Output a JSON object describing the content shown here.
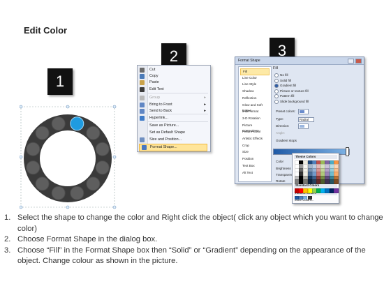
{
  "title": "Edit Color",
  "badges": [
    "1",
    "2",
    "3"
  ],
  "context_menu": {
    "items": [
      {
        "label": "Cut",
        "icon": "scissors-icon",
        "color": "#6b6b6b",
        "disabled": false,
        "submenu": false,
        "active": false
      },
      {
        "label": "Copy",
        "icon": "copy-icon",
        "color": "#4a7ab8",
        "disabled": false,
        "submenu": false,
        "active": false
      },
      {
        "label": "Paste",
        "icon": "paste-icon",
        "color": "#c9a24a",
        "disabled": false,
        "submenu": false,
        "active": false
      },
      {
        "label": "Edit Text",
        "icon": "edit-text-icon",
        "color": "#3b3b3b",
        "disabled": false,
        "submenu": false,
        "active": false
      },
      {
        "label": "Group",
        "icon": "group-icon",
        "color": "#b9b9b9",
        "disabled": true,
        "submenu": true,
        "active": false
      },
      {
        "label": "Bring to Front",
        "icon": "bring-front-icon",
        "color": "#5f86c4",
        "disabled": false,
        "submenu": true,
        "active": false
      },
      {
        "label": "Send to Back",
        "icon": "send-back-icon",
        "color": "#5f86c4",
        "disabled": false,
        "submenu": true,
        "active": false
      },
      {
        "label": "Hyperlink...",
        "icon": "hyperlink-icon",
        "color": "#3f7bc8",
        "disabled": false,
        "submenu": false,
        "active": false
      },
      {
        "label": "Save as Picture...",
        "icon": "",
        "color": "",
        "disabled": false,
        "submenu": false,
        "active": false
      },
      {
        "label": "Set as Default Shape",
        "icon": "",
        "color": "",
        "disabled": false,
        "submenu": false,
        "active": false
      },
      {
        "label": "Size and Position...",
        "icon": "size-icon",
        "color": "#6f8fc0",
        "disabled": false,
        "submenu": false,
        "active": false
      },
      {
        "label": "Format Shape...",
        "icon": "format-shape-icon",
        "color": "#4a78c0",
        "disabled": false,
        "submenu": false,
        "active": true
      }
    ]
  },
  "dialog": {
    "title": "Format Shape",
    "nav": [
      "Fill",
      "Line Color",
      "Line Style",
      "Shadow",
      "Reflection",
      "Glow and Soft Edges",
      "3-D Format",
      "3-D Rotation",
      "Picture Corrections",
      "Picture Color",
      "Artistic Effects",
      "Crop",
      "Size",
      "Position",
      "Text Box",
      "Alt Text"
    ],
    "fill_header": "Fill",
    "options": [
      "No fill",
      "Solid fill",
      "Gradient fill",
      "Picture or texture fill",
      "Pattern fill",
      "Slide background fill"
    ],
    "selected_option": 2,
    "labels": {
      "preset": "Preset colors:",
      "type": "Type:",
      "type_value": "Radial",
      "direction": "Direction:",
      "angle": "Angle:",
      "gradient_stops": "Gradient stops",
      "color": "Color",
      "position": "Position:",
      "position_value": "100%",
      "brightness": "Brightness",
      "transparency": "Transparency",
      "rotate": "Rotate"
    },
    "popup": {
      "theme_colors": "Theme Colors",
      "standard_colors": "Standard Colors",
      "recent_colors": "Recent Colors",
      "more_colors": "More Colors..."
    }
  },
  "instructions": [
    "Select the shape to change the color and Right click the object( click any object which you want to change color)",
    "Choose Format Shape in the dialog box.",
    "Choose “Fill” in the Format Shape box then “Solid” or “Gradient” depending on the appearance of the object. Change colour as shown in the picture."
  ],
  "colors": {
    "ring": "#3a3a3a",
    "circle": "#5e5e5e",
    "selected_circle": "#1f9be0",
    "menu_highlight": "#ffe59a"
  }
}
